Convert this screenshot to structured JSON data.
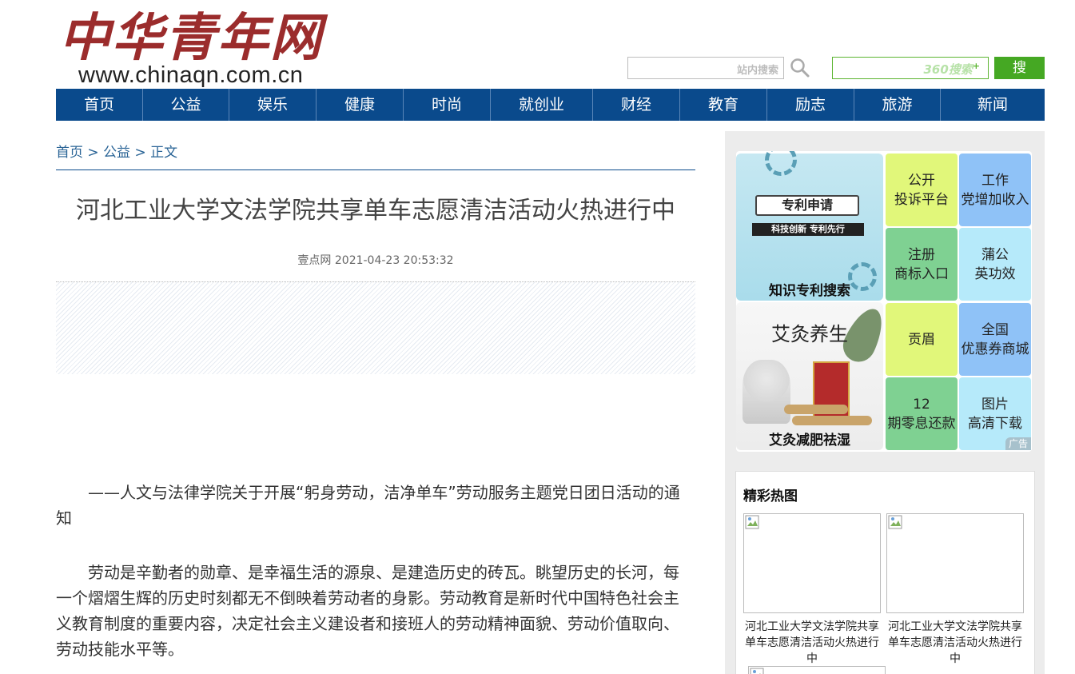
{
  "header": {
    "logo_text": "中华青年网",
    "logo_url": "www.chinaqn.com.cn",
    "site_search_placeholder": "站内搜索",
    "search360_placeholder": "360搜索",
    "search_button": "搜 索"
  },
  "nav": [
    {
      "label": "首页"
    },
    {
      "label": "公益"
    },
    {
      "label": "娱乐"
    },
    {
      "label": "健康"
    },
    {
      "label": "时尚"
    },
    {
      "label": "就创业"
    },
    {
      "label": "财经"
    },
    {
      "label": "教育"
    },
    {
      "label": "励志"
    },
    {
      "label": "旅游"
    },
    {
      "label": "新闻"
    }
  ],
  "breadcrumb": {
    "home": "首页",
    "sep": ">",
    "section": "公益",
    "current": "正文"
  },
  "article": {
    "title": "河北工业大学文法学院共享单车志愿清洁活动火热进行中",
    "source": "壹点网",
    "datetime": "2021-04-23 20:53:32",
    "paragraphs": [
      "——人文与法律学院关于开展“躬身劳动，洁净单车”劳动服务主题党日团日活动的通知",
      "劳动是辛勤者的勋章、是幸福生活的源泉、是建造历史的砖瓦。眺望历史的长河，每一个熠熠生辉的历史时刻都无不倒映着劳动者的身影。劳动教育是新时代中国特色社会主义教育制度的重要内容，决定社会主义建设者和接班人的劳动精神面貌、劳动价值取向、劳动技能水平等。"
    ]
  },
  "sidebar": {
    "ad_images": [
      {
        "label": "知识专利搜索",
        "banner": "专利申请",
        "sub": "科技创新 专利先行"
      },
      {
        "label": "艾灸减肥祛湿",
        "banner": "艾灸养生"
      }
    ],
    "ad_tiles": [
      {
        "line1": "公开",
        "line2": "投诉平台",
        "color": "#e1f77a"
      },
      {
        "line1": "工作",
        "line2": "党增加收入",
        "color": "#8fc2f7"
      },
      {
        "line1": "注册",
        "line2": "商标入口",
        "color": "#7fd192"
      },
      {
        "line1": "蒲公",
        "line2": "英功效",
        "color": "#b6eafa"
      },
      {
        "line1": "贡眉",
        "line2": "",
        "color": "#e1f77a"
      },
      {
        "line1": "全国",
        "line2": "优惠券商城",
        "color": "#8fc2f7"
      },
      {
        "line1": "12",
        "line2": "期零息还款",
        "color": "#7fd192"
      },
      {
        "line1": "图片",
        "line2": "高清下载",
        "color": "#b6eafa"
      }
    ],
    "ad_tag": "广告",
    "hot": {
      "title": "精彩热图",
      "items": [
        {
          "caption": "河北工业大学文法学院共享单车志愿清洁活动火热进行中"
        },
        {
          "caption": "河北工业大学文法学院共享单车志愿清洁活动火热进行中"
        }
      ]
    }
  },
  "colors": {
    "nav_bg": "#0a4a8c",
    "logo_red": "#9b2c2c",
    "search_green": "#45a823",
    "link_blue": "#2a6496"
  }
}
